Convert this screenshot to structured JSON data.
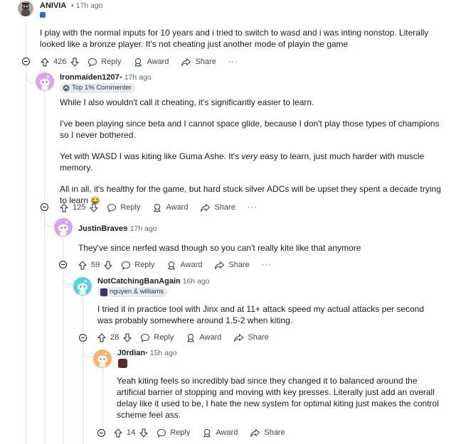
{
  "comments": {
    "c1": {
      "username": "ANIVIA",
      "time": "17h ago",
      "body": [
        "I play with the normal inputs for 10 years and i tried to switch to wasd and i was inting nonstop. Literally looked like a bronze player. It's not cheating just another mode of playin the game"
      ],
      "votes": "426"
    },
    "c2": {
      "username": "Ironmaiden1207",
      "time": "17h ago",
      "flair": "Top 1% Commenter",
      "body_p1": "While I also wouldn't call it cheating, it's significantly easier to learn.",
      "body_p2": "I've been playing since beta and I cannot space glide, because I don't play those types of champions so I never bothered.",
      "body_p3_before": "Yet with WASD I was kiting like Guma Ashe. It's ",
      "body_p3_em": "very",
      "body_p3_after": " easy to learn, just much harder with muscle memory.",
      "body_p4": "All in all, it's healthy for the game, but hard stuck silver ADCs will be upset they spent a decade trying to learn",
      "emoji": "😂",
      "votes": "125"
    },
    "c3": {
      "username": "JustinBraves",
      "time": "17h ago",
      "body": "They've since nerfed wasd though so you can't really kite like that anymore",
      "votes": "59"
    },
    "c4": {
      "username": "NotCatchingBanAgain",
      "time": "16h ago",
      "flair": "nguyen & williams",
      "body": "I tried it in practice tool with Jinx and at 11+ attack speed my actual attacks per second was probably somewhere around 1.5-2 when kiting.",
      "votes": "28"
    },
    "c5": {
      "username": "J0rdian",
      "time": "15h ago",
      "body": "Yeah kiting feels so incredibly bad since they changed it to balanced around the artificial barrier of stopping and moving with key presses. Literally just add an overall delay like it used to be, I hate the new system for optimal kiting just makes the control scheme feel ass.",
      "votes": "14"
    }
  },
  "actions": {
    "reply": "Reply",
    "award": "Award",
    "share": "Share",
    "more": "···"
  },
  "meta_separator": "•",
  "colors": {
    "text": "#1c1c1c",
    "meta": "#5c6c74",
    "thread": "#dbe0e3",
    "flair_bg": "#e5ebee",
    "snoo_purple": "#d4a4ee",
    "snoo_cyan": "#4fd4e6",
    "snoo_orange": "#f6b26b"
  },
  "icons": [
    "collapse-icon",
    "upvote-icon",
    "downvote-icon",
    "reply-icon",
    "award-icon",
    "share-icon",
    "more-icon",
    "emoji-laugh"
  ]
}
